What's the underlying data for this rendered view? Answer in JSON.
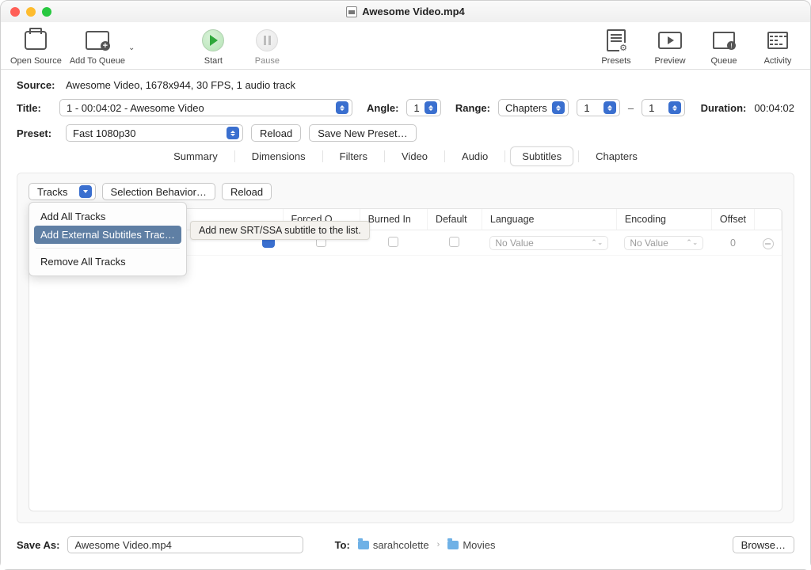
{
  "window": {
    "title": "Awesome Video.mp4"
  },
  "toolbar": {
    "open_source": "Open Source",
    "add_to_queue": "Add To Queue",
    "start": "Start",
    "pause": "Pause",
    "presets": "Presets",
    "preview": "Preview",
    "queue": "Queue",
    "activity": "Activity"
  },
  "source": {
    "label": "Source:",
    "value": "Awesome Video, 1678x944, 30 FPS, 1 audio track"
  },
  "title_row": {
    "label": "Title:",
    "value": "1 - 00:04:02 - Awesome Video",
    "angle_label": "Angle:",
    "angle_value": "1",
    "range_label": "Range:",
    "range_mode": "Chapters",
    "range_from": "1",
    "range_to": "1",
    "duration_label": "Duration:",
    "duration_value": "00:04:02"
  },
  "preset_row": {
    "label": "Preset:",
    "value": "Fast 1080p30",
    "reload": "Reload",
    "save_new": "Save New Preset…"
  },
  "tabs": {
    "summary": "Summary",
    "dimensions": "Dimensions",
    "filters": "Filters",
    "video": "Video",
    "audio": "Audio",
    "subtitles": "Subtitles",
    "chapters": "Chapters"
  },
  "subtitles_panel": {
    "tracks_btn": "Tracks",
    "selection_behavior": "Selection Behavior…",
    "reload": "Reload",
    "menu": {
      "add_all": "Add All Tracks",
      "add_external": "Add External Subtitles Track…",
      "remove_all": "Remove All Tracks"
    },
    "tooltip": "Add new SRT/SSA subtitle to the list.",
    "headers": {
      "forced": "Forced O…",
      "burned": "Burned In",
      "default": "Default",
      "language": "Language",
      "encoding": "Encoding",
      "offset": "Offset"
    },
    "row": {
      "language": "No Value",
      "encoding": "No Value",
      "offset": "0"
    }
  },
  "footer": {
    "save_as_label": "Save As:",
    "save_as_value": "Awesome Video.mp4",
    "to_label": "To:",
    "path_user": "sarahcolette",
    "path_folder": "Movies",
    "browse": "Browse…"
  }
}
